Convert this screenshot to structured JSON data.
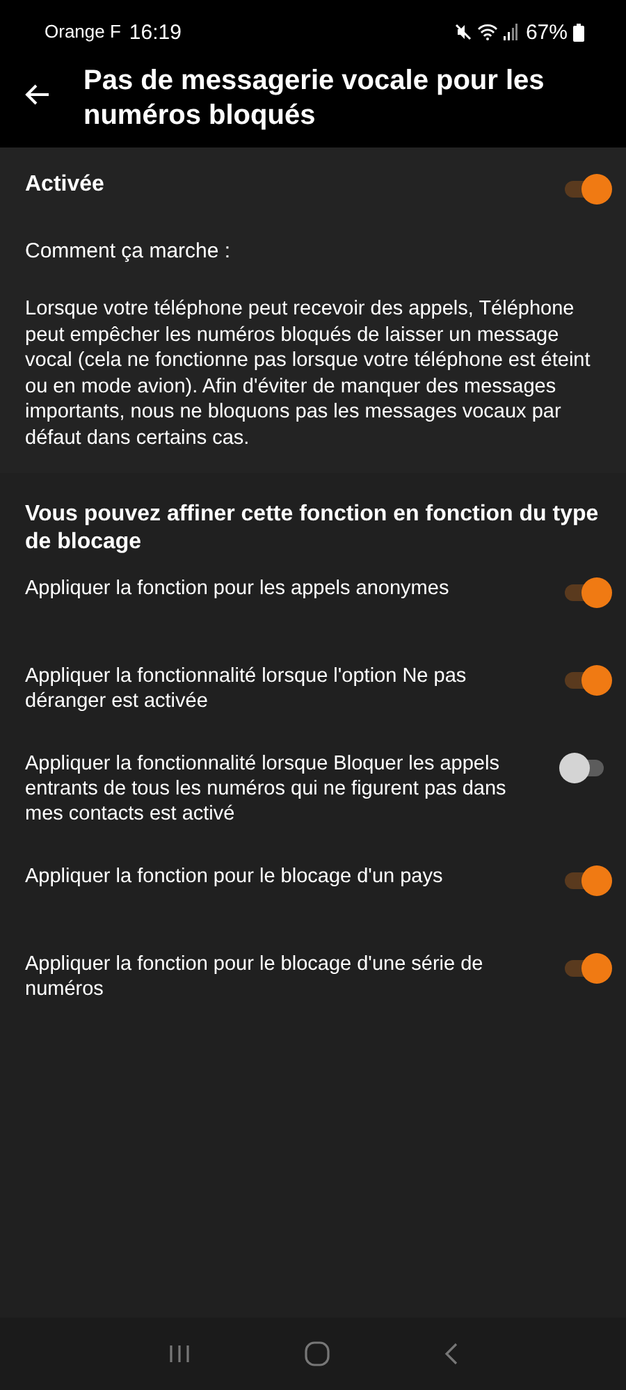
{
  "status_bar": {
    "carrier": "Orange F",
    "time": "16:19",
    "battery": "67%"
  },
  "header": {
    "title": "Pas de messagerie vocale pour les numéros bloqués"
  },
  "master": {
    "label": "Activée",
    "on": true
  },
  "help": {
    "heading": "Comment ça marche :",
    "body": "Lorsque votre téléphone peut recevoir des appels, Téléphone peut empêcher les numéros bloqués de laisser un message vocal (cela ne fonctionne pas lorsque votre téléphone est éteint ou en mode avion). Afin d'éviter de manquer des messages importants, nous ne bloquons pas les messages vocaux par défaut dans certains cas."
  },
  "section": {
    "title": "Vous pouvez affiner cette fonction en fonction du type de blocage"
  },
  "options": [
    {
      "label": "Appliquer la fonction pour les appels anonymes",
      "on": true
    },
    {
      "label": "Appliquer la fonctionnalité lorsque l'option Ne pas déranger est activée",
      "on": true
    },
    {
      "label": "Appliquer la fonctionnalité lorsque Bloquer les appels entrants de tous les numéros qui ne figurent pas dans mes contacts est activé",
      "on": false
    },
    {
      "label": "Appliquer la fonction pour le blocage d'un pays",
      "on": true
    },
    {
      "label": "Appliquer la fonction pour le blocage d'une série de numéros",
      "on": true
    }
  ]
}
